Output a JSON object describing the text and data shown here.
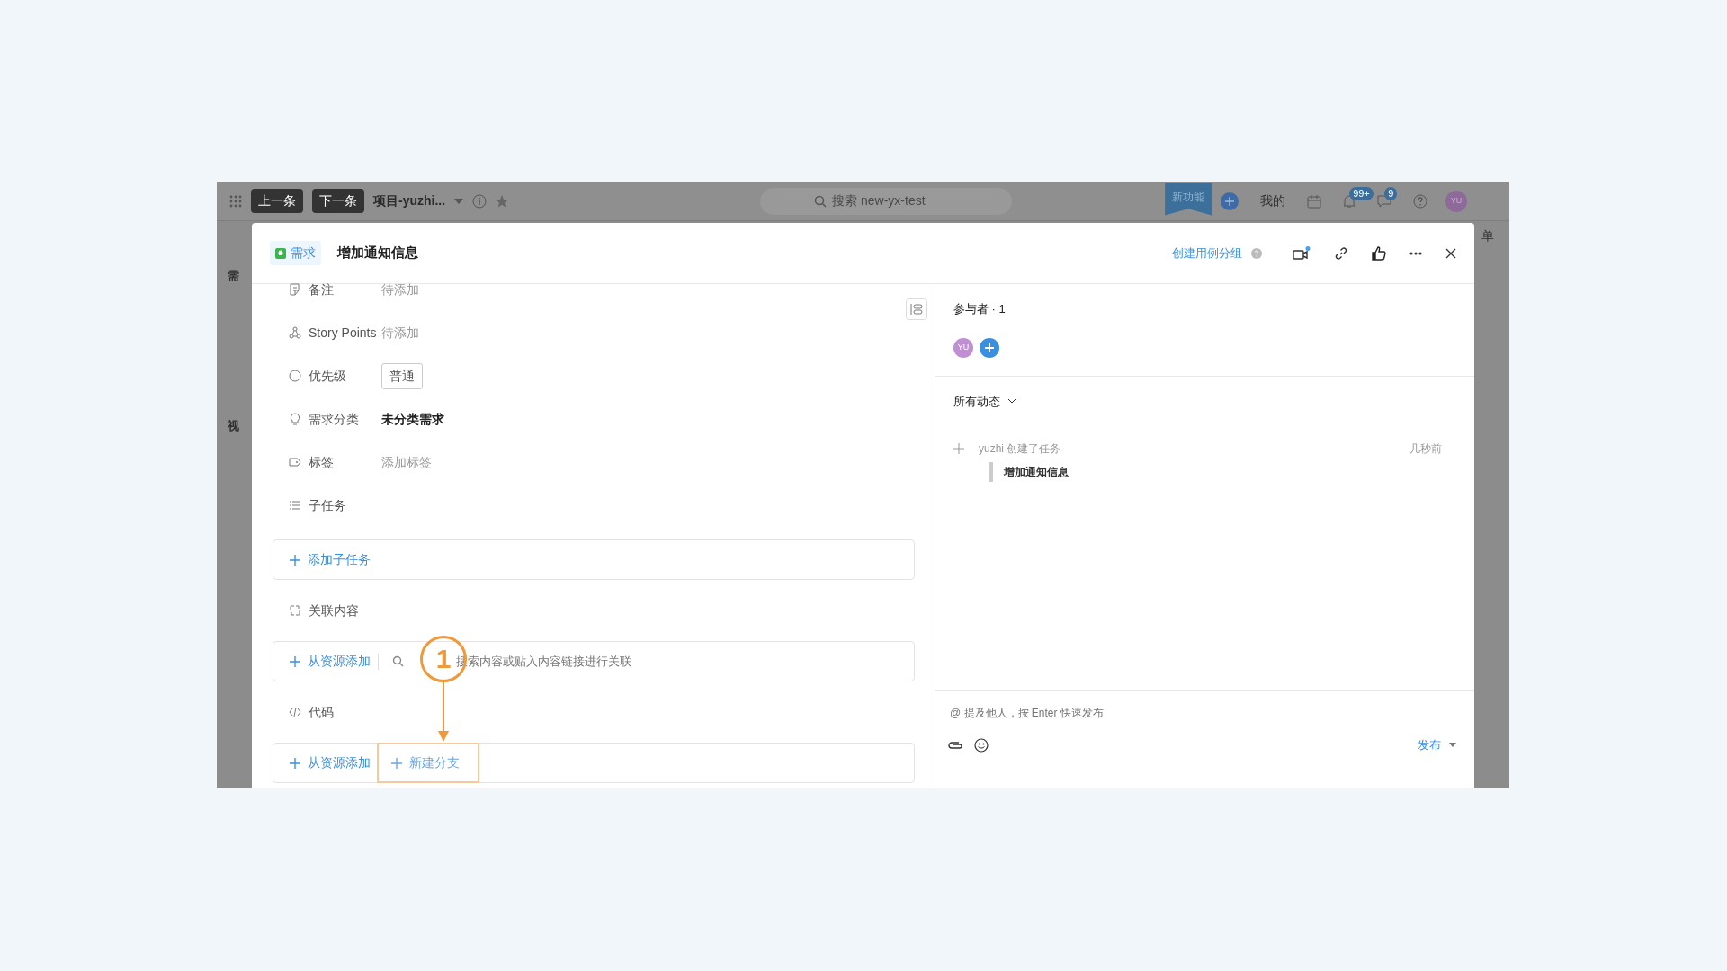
{
  "topbar": {
    "prev": "上一条",
    "next": "下一条",
    "project": "项目-yuzhi...",
    "search_placeholder": "搜索 new-yx-test",
    "ribbon": "新功能",
    "mine": "我的",
    "notifications": "99+",
    "messages": "9",
    "avatar": "YU"
  },
  "background": {
    "left_labels": [
      "需",
      "视"
    ],
    "right_label": "单"
  },
  "modal": {
    "type_tag": "需求",
    "title": "增加通知信息",
    "create_group": "创建用例分组",
    "fields": [
      {
        "kind": "placeholder",
        "label": "备注",
        "value": "待添加"
      },
      {
        "kind": "placeholder",
        "label": "Story Points",
        "value": "待添加"
      },
      {
        "kind": "tag",
        "label": "优先级",
        "value": "普通"
      },
      {
        "kind": "value",
        "label": "需求分类",
        "value": "未分类需求"
      },
      {
        "kind": "placeholder",
        "label": "标签",
        "value": "添加标签"
      },
      {
        "kind": "section",
        "label": "子任务"
      }
    ],
    "subtask_add": "添加子任务",
    "related": {
      "label": "关联内容",
      "add": "从资源添加",
      "placeholder": "搜索内容或贴入内容链接进行关联"
    },
    "code": {
      "label": "代码",
      "add": "从资源添加",
      "new_branch": "新建分支",
      "highlighted": true
    },
    "participants": {
      "title": "参与者 · 1",
      "avatar": "YU"
    },
    "activity": {
      "filter": "所有动态",
      "items": [
        {
          "text": "yuzhi 创建了任务",
          "time": "几秒前",
          "quote": "增加通知信息"
        }
      ]
    },
    "comment": {
      "placeholder": "@ 提及他人，按 Enter 快速发布",
      "submit": "发布"
    }
  },
  "annotation": {
    "step": "1"
  }
}
